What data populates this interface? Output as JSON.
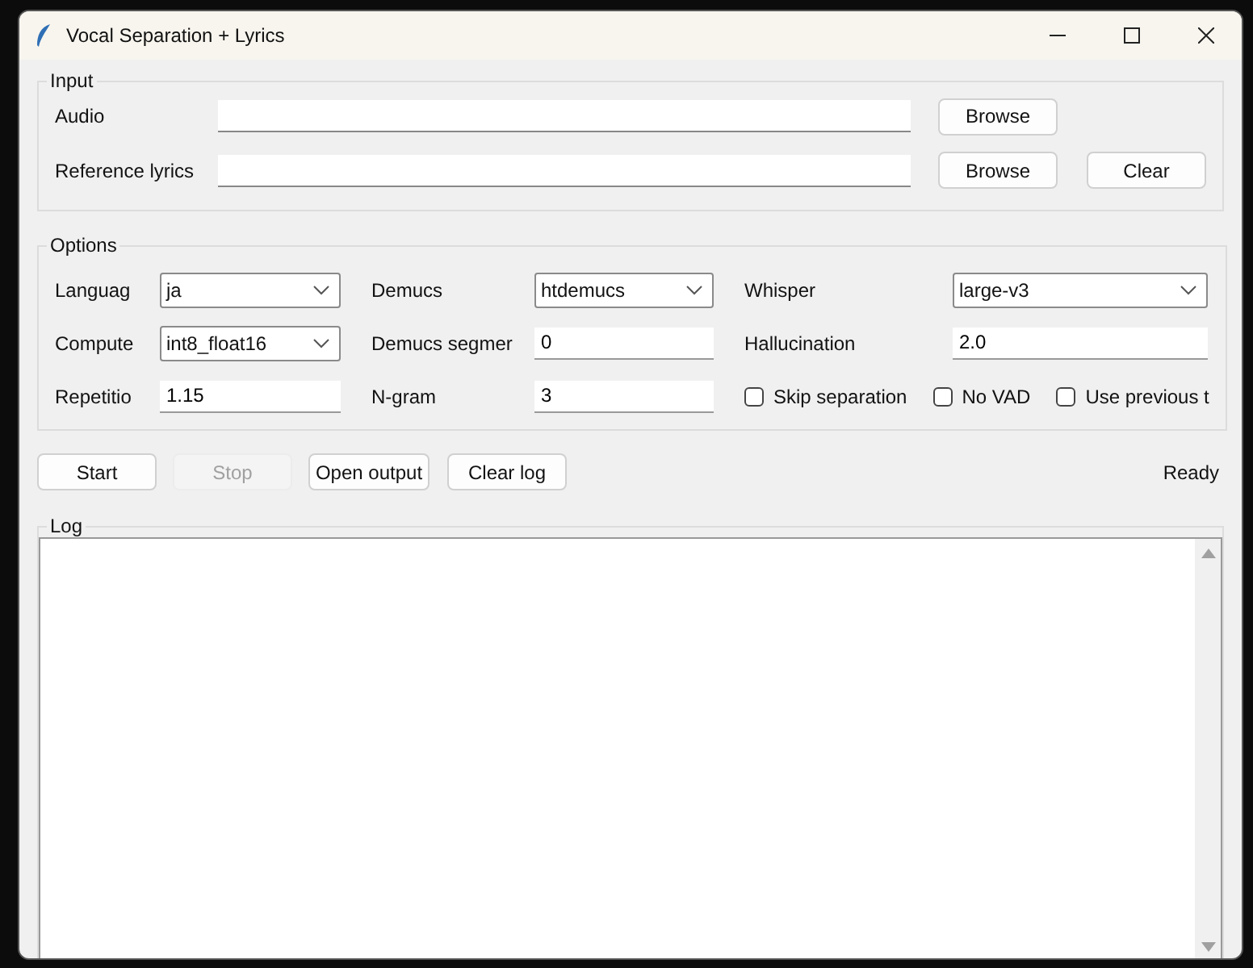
{
  "window": {
    "title": "Vocal Separation + Lyrics"
  },
  "input": {
    "title": "Input",
    "rows": [
      {
        "label": "Audio",
        "buttons": [
          "Browse"
        ]
      },
      {
        "label": "Reference lyrics",
        "buttons": [
          "Browse",
          "Clear"
        ]
      }
    ]
  },
  "options": {
    "title": "Options",
    "rows": [
      [
        {
          "kind": "combo",
          "label": "Languag",
          "value": "ja"
        },
        {
          "kind": "combo",
          "label": "Demucs",
          "value": "htdemucs"
        },
        {
          "kind": "combo",
          "label": "Whisper",
          "value": "large-v3"
        }
      ],
      [
        {
          "kind": "combo",
          "label": "Compute",
          "value": "int8_float16"
        },
        {
          "kind": "entry",
          "label": "Demucs segmer",
          "value": "0"
        },
        {
          "kind": "entry",
          "label": "Hallucination",
          "value": "2.0"
        }
      ],
      [
        {
          "kind": "entry",
          "label": "Repetitio",
          "value": "1.15"
        },
        {
          "kind": "entry",
          "label": "N-gram",
          "value": "3"
        },
        {
          "kind": "checks",
          "items": [
            {
              "label": "Skip separation",
              "checked": false
            },
            {
              "label": "No VAD",
              "checked": false
            },
            {
              "label": "Use previous t",
              "checked": false
            }
          ]
        }
      ]
    ]
  },
  "actions": {
    "buttons": [
      {
        "label": "Start",
        "disabled": false
      },
      {
        "label": "Stop",
        "disabled": true
      },
      {
        "label": "Open output",
        "disabled": false
      },
      {
        "label": "Clear log",
        "disabled": false
      }
    ],
    "status": "Ready"
  },
  "log": {
    "title": "Log"
  }
}
